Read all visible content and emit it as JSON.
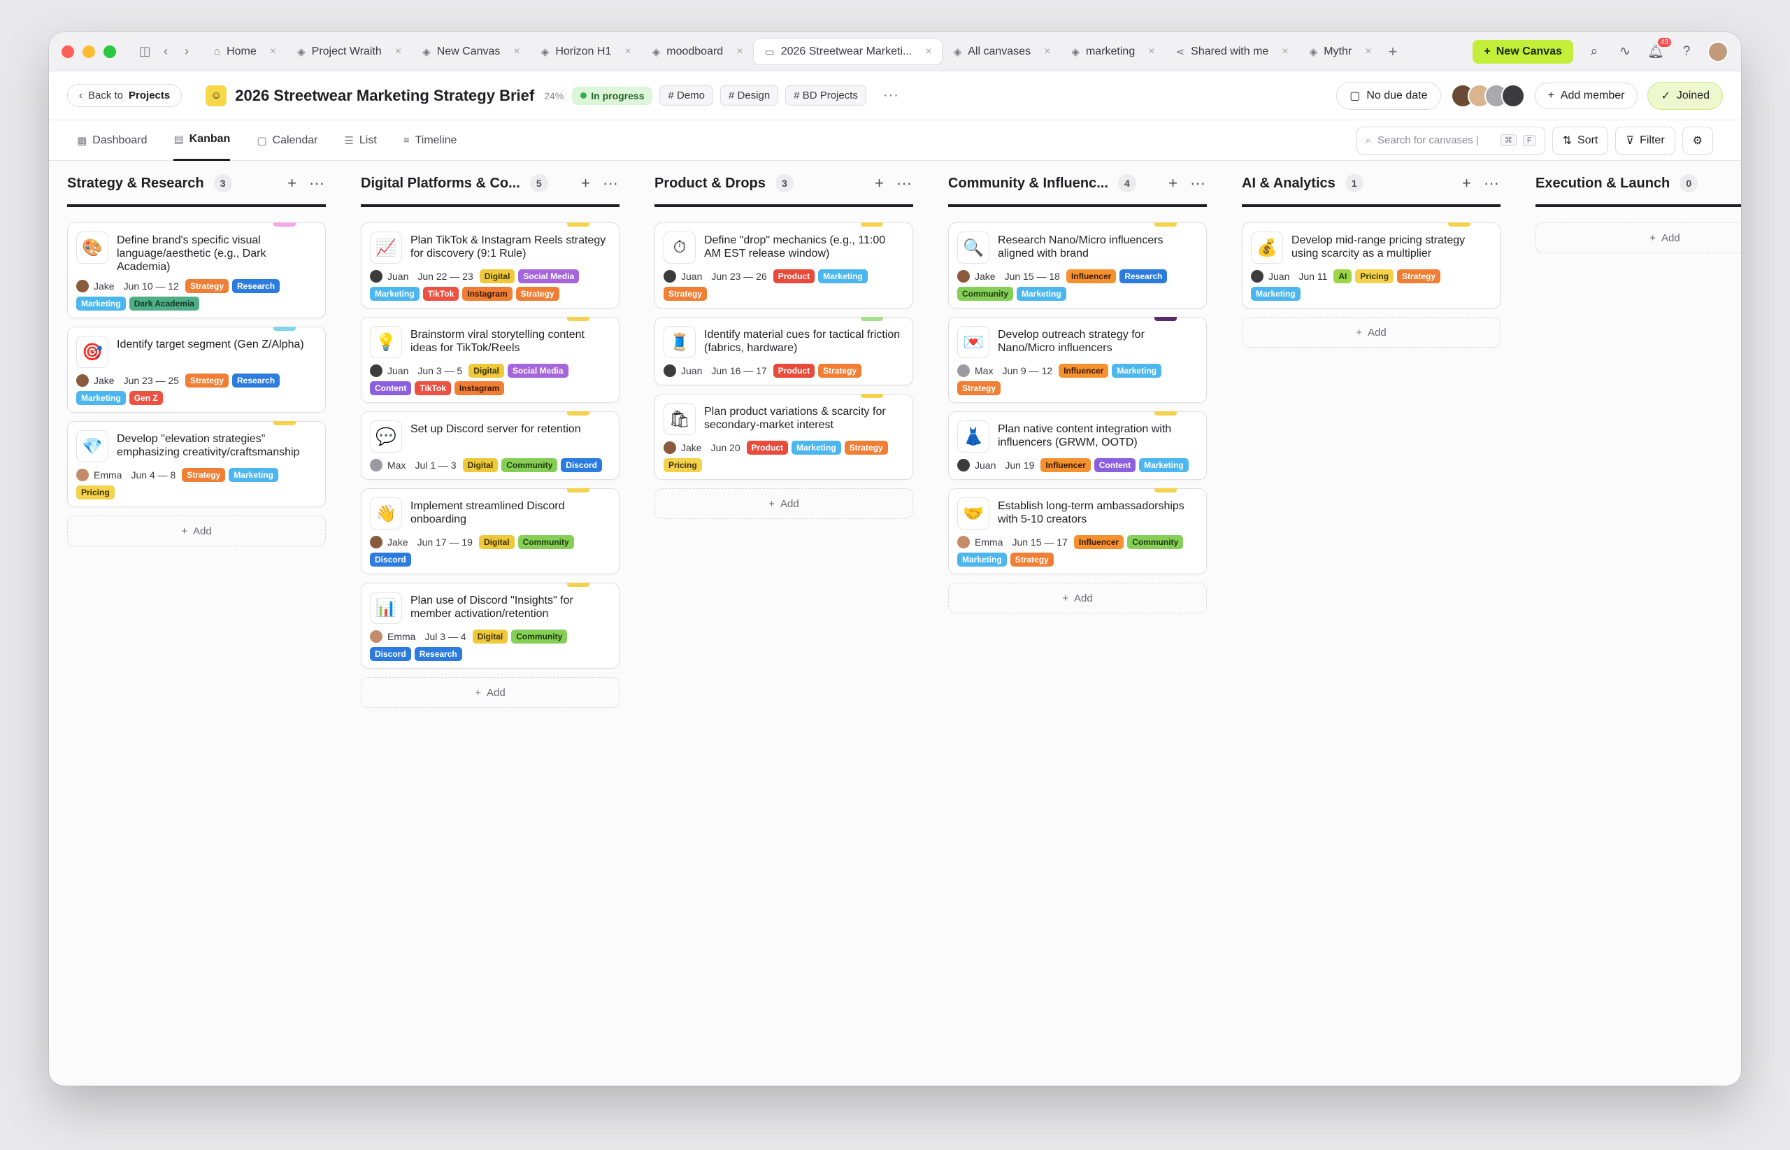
{
  "tabbar": {
    "tabs": [
      {
        "label": "Home",
        "icon": "home-icon",
        "glyph": "⌂",
        "active": false
      },
      {
        "label": "Project Wraith",
        "icon": "layers-icon",
        "glyph": "◈",
        "active": false
      },
      {
        "label": "New Canvas",
        "icon": "layers-icon",
        "glyph": "◈",
        "active": false
      },
      {
        "label": "Horizon H1",
        "icon": "layers-icon",
        "glyph": "◈",
        "active": false
      },
      {
        "label": "moodboard",
        "icon": "layers-icon",
        "glyph": "◈",
        "active": false
      },
      {
        "label": "2026 Streetwear Marketi...",
        "icon": "folder-icon",
        "glyph": "▭",
        "active": true
      },
      {
        "label": "All canvases",
        "icon": "layers-icon",
        "glyph": "◈",
        "active": false
      },
      {
        "label": "marketing",
        "icon": "layers-icon",
        "glyph": "◈",
        "active": false
      },
      {
        "label": "Shared with me",
        "icon": "share-icon",
        "glyph": "⋖",
        "active": false
      },
      {
        "label": "Mythr",
        "icon": "layers-icon",
        "glyph": "◈",
        "active": false
      }
    ],
    "new_canvas": "New Canvas",
    "notification_count": "43"
  },
  "header": {
    "back_prefix": "Back to",
    "back_target": "Projects",
    "title": "2026 Streetwear Marketing Strategy Brief",
    "progress": "24%",
    "status": "In progress",
    "tags": [
      "# Demo",
      "# Design",
      "# BD Projects"
    ],
    "due": "No due date",
    "add_member": "Add member",
    "joined": "Joined"
  },
  "views": {
    "tabs": [
      {
        "label": "Dashboard",
        "glyph": "▦",
        "icon": "dashboard-icon",
        "active": false
      },
      {
        "label": "Kanban",
        "glyph": "▤",
        "icon": "kanban-icon",
        "active": true
      },
      {
        "label": "Calendar",
        "glyph": "▢",
        "icon": "calendar-icon",
        "active": false
      },
      {
        "label": "List",
        "glyph": "☰",
        "icon": "list-icon",
        "active": false
      },
      {
        "label": "Timeline",
        "glyph": "≡",
        "icon": "timeline-icon",
        "active": false
      }
    ],
    "search_placeholder": "Search for canvases |",
    "kbd1": "⌘",
    "kbd2": "F",
    "sort": "Sort",
    "filter": "Filter"
  },
  "colors": {
    "accent": "#c3ee3a",
    "status_green": "#33b24a",
    "stripe_yellow": "#f4d24b",
    "stripe_pink": "#f2a8e8",
    "stripe_cyan": "#7fd6e8",
    "stripe_green": "#a8e08a",
    "stripe_purple": "#5a2a6b"
  },
  "columns": [
    {
      "title": "Strategy & Research",
      "count": "3",
      "cards": [
        {
          "emoji": "🎨",
          "title": "Define brand's specific visual language/aesthetic (e.g., Dark Academia)",
          "assignee": "Jake",
          "date": "Jun 10 — 12",
          "stripe": "#f2a8e8",
          "av": "#8a5a3c",
          "tags": [
            [
              "Strategy",
              "strategy"
            ],
            [
              "Research",
              "research"
            ],
            [
              "Marketing",
              "marketing"
            ],
            [
              "Dark Academia",
              "darkacademia"
            ]
          ]
        },
        {
          "emoji": "🎯",
          "title": "Identify target segment (Gen Z/Alpha)",
          "assignee": "Jake",
          "date": "Jun 23 — 25",
          "stripe": "#7fd6e8",
          "av": "#8a5a3c",
          "tags": [
            [
              "Strategy",
              "strategy"
            ],
            [
              "Research",
              "research"
            ],
            [
              "Marketing",
              "marketing"
            ],
            [
              "Gen Z",
              "genz"
            ]
          ]
        },
        {
          "emoji": "💎",
          "title": "Develop \"elevation strategies\" emphasizing creativity/craftsmanship",
          "assignee": "Emma",
          "date": "Jun 4 — 8",
          "stripe": "#f4d24b",
          "av": "#c48b6a",
          "tags": [
            [
              "Strategy",
              "strategy"
            ],
            [
              "Marketing",
              "marketing"
            ],
            [
              "Pricing",
              "pricing"
            ]
          ]
        }
      ]
    },
    {
      "title": "Digital Platforms & Co...",
      "count": "5",
      "cards": [
        {
          "emoji": "📈",
          "title": "Plan TikTok & Instagram Reels strategy for discovery (9:1 Rule)",
          "assignee": "Juan",
          "date": "Jun 22 — 23",
          "stripe": "#f4d24b",
          "av": "#3c3c3c",
          "tags": [
            [
              "Digital",
              "digital"
            ],
            [
              "Social Media",
              "socialmedia"
            ],
            [
              "Marketing",
              "marketing"
            ],
            [
              "TikTok",
              "tiktok"
            ],
            [
              "Instagram",
              "instagram"
            ],
            [
              "Strategy",
              "strategy"
            ]
          ]
        },
        {
          "emoji": "💡",
          "title": "Brainstorm viral storytelling content ideas for TikTok/Reels",
          "assignee": "Juan",
          "date": "Jun 3 — 5",
          "stripe": "#f4d24b",
          "av": "#3c3c3c",
          "tags": [
            [
              "Digital",
              "digital"
            ],
            [
              "Social Media",
              "socialmedia"
            ],
            [
              "Content",
              "content"
            ],
            [
              "TikTok",
              "tiktok"
            ],
            [
              "Instagram",
              "instagram"
            ]
          ]
        },
        {
          "emoji": "💬",
          "title": "Set up Discord server for retention",
          "assignee": "Max",
          "date": "Jul 1 — 3",
          "stripe": "#f4d24b",
          "av": "#9a9aa0",
          "tags": [
            [
              "Digital",
              "digital"
            ],
            [
              "Community",
              "community"
            ],
            [
              "Discord",
              "discord"
            ]
          ]
        },
        {
          "emoji": "👋",
          "title": "Implement streamlined Discord onboarding",
          "assignee": "Jake",
          "date": "Jun 17 — 19",
          "stripe": "#f4d24b",
          "av": "#8a5a3c",
          "tags": [
            [
              "Digital",
              "digital"
            ],
            [
              "Community",
              "community"
            ],
            [
              "Discord",
              "discord"
            ]
          ]
        },
        {
          "emoji": "📊",
          "title": "Plan use of Discord \"Insights\" for member activation/retention",
          "assignee": "Emma",
          "date": "Jul 3 — 4",
          "stripe": "#f4d24b",
          "av": "#c48b6a",
          "tags": [
            [
              "Digital",
              "digital"
            ],
            [
              "Community",
              "community"
            ],
            [
              "Discord",
              "discord"
            ],
            [
              "Research",
              "research"
            ]
          ]
        }
      ]
    },
    {
      "title": "Product & Drops",
      "count": "3",
      "cards": [
        {
          "emoji": "⏱",
          "title": "Define \"drop\" mechanics (e.g., 11:00 AM EST release window)",
          "assignee": "Juan",
          "date": "Jun 23 — 26",
          "stripe": "#f4d24b",
          "av": "#3c3c3c",
          "tags": [
            [
              "Product",
              "product"
            ],
            [
              "Marketing",
              "marketing"
            ],
            [
              "Strategy",
              "strategy"
            ]
          ]
        },
        {
          "emoji": "🧵",
          "title": "Identify material cues for tactical friction (fabrics, hardware)",
          "assignee": "Juan",
          "date": "Jun 16 — 17",
          "stripe": "#a8e08a",
          "av": "#3c3c3c",
          "tags": [
            [
              "Product",
              "product"
            ],
            [
              "Strategy",
              "strategy"
            ]
          ]
        },
        {
          "emoji": "🛍",
          "title": "Plan product variations & scarcity for secondary-market interest",
          "assignee": "Jake",
          "date": "Jun 20",
          "stripe": "#f4d24b",
          "av": "#8a5a3c",
          "tags": [
            [
              "Product",
              "product"
            ],
            [
              "Marketing",
              "marketing"
            ],
            [
              "Strategy",
              "strategy"
            ],
            [
              "Pricing",
              "pricing"
            ]
          ]
        }
      ]
    },
    {
      "title": "Community & Influenc...",
      "count": "4",
      "cards": [
        {
          "emoji": "🔍",
          "title": "Research Nano/Micro influencers aligned with brand",
          "assignee": "Jake",
          "date": "Jun 15 — 18",
          "stripe": "#f4d24b",
          "av": "#8a5a3c",
          "tags": [
            [
              "Influencer",
              "influencer"
            ],
            [
              "Research",
              "research"
            ],
            [
              "Community",
              "community"
            ],
            [
              "Marketing",
              "marketing"
            ]
          ]
        },
        {
          "emoji": "💌",
          "title": "Develop outreach strategy for Nano/Micro influencers",
          "assignee": "Max",
          "date": "Jun 9 — 12",
          "stripe": "#5a2a6b",
          "av": "#9a9aa0",
          "tags": [
            [
              "Influencer",
              "influencer"
            ],
            [
              "Marketing",
              "marketing"
            ],
            [
              "Strategy",
              "strategy"
            ]
          ]
        },
        {
          "emoji": "👗",
          "title": "Plan native content integration with influencers (GRWM, OOTD)",
          "assignee": "Juan",
          "date": "Jun 19",
          "stripe": "#f4d24b",
          "av": "#3c3c3c",
          "tags": [
            [
              "Influencer",
              "influencer"
            ],
            [
              "Content",
              "content"
            ],
            [
              "Marketing",
              "marketing"
            ]
          ]
        },
        {
          "emoji": "🤝",
          "title": "Establish long-term ambassadorships with 5-10 creators",
          "assignee": "Emma",
          "date": "Jun 15 — 17",
          "stripe": "#f4d24b",
          "av": "#c48b6a",
          "tags": [
            [
              "Influencer",
              "influencer"
            ],
            [
              "Community",
              "community"
            ],
            [
              "Marketing",
              "marketing"
            ],
            [
              "Strategy",
              "strategy"
            ]
          ]
        }
      ]
    },
    {
      "title": "AI & Analytics",
      "count": "1",
      "cards": [
        {
          "emoji": "💰",
          "title": "Develop mid-range pricing strategy using scarcity as a multiplier",
          "assignee": "Juan",
          "date": "Jun 11",
          "stripe": "#f4d24b",
          "av": "#3c3c3c",
          "tags": [
            [
              "AI",
              "ai"
            ],
            [
              "Pricing",
              "pricing"
            ],
            [
              "Strategy",
              "strategy"
            ],
            [
              "Marketing",
              "marketing"
            ]
          ]
        }
      ]
    },
    {
      "title": "Execution & Launch",
      "count": "0",
      "cards": []
    }
  ],
  "add_label": "Add"
}
